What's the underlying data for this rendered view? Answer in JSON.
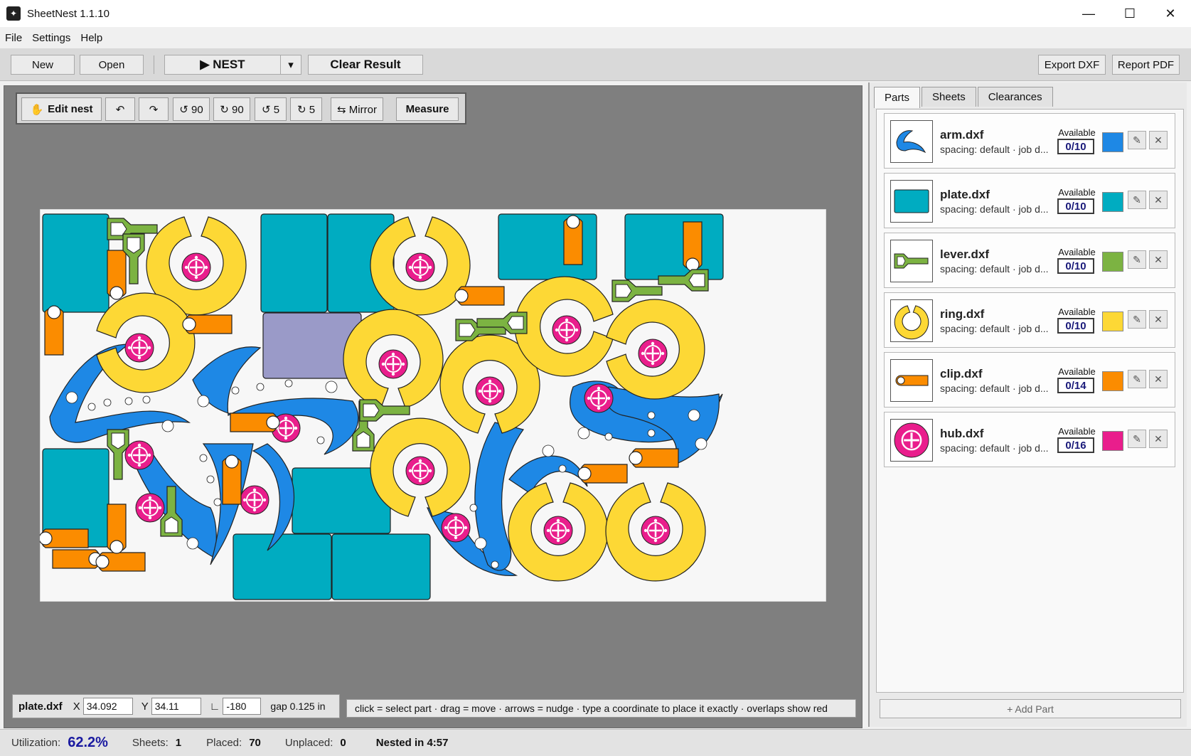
{
  "window": {
    "title": "SheetNest 1.1.10",
    "app_icon": "nest-icon"
  },
  "menu": [
    "File",
    "Settings",
    "Help"
  ],
  "toolbar": {
    "new": "New",
    "open": "Open",
    "nest": "▶  NEST",
    "nest_dropdown": "▾",
    "clear": "Clear Result",
    "export_dxf": "Export DXF",
    "report_pdf": "Report PDF"
  },
  "edit_toolbar": {
    "edit_nest": "Edit nest",
    "undo": "↶",
    "redo": "↷",
    "rot_ccw_90": "↺ 90",
    "rot_cw_90": "↻ 90",
    "rot_ccw_5": "↺ 5",
    "rot_cw_5": "↻ 5",
    "mirror": "⇆ Mirror",
    "measure": "Measure"
  },
  "coord_bar": {
    "part": "plate.dxf",
    "x_label": "X",
    "x": "34.092",
    "y_label": "Y",
    "y": "34.11",
    "angle_label": "∟",
    "angle": "-180",
    "gap": "gap 0.125 in"
  },
  "hint": "click = select part  ·  drag = move  ·  arrows = nudge  ·  type a coordinate to place it exactly  ·  overlaps show red",
  "tabs": [
    "Parts",
    "Sheets",
    "Clearances"
  ],
  "parts": [
    {
      "name": "arm.dxf",
      "spacing": "spacing: default · job d...",
      "available_label": "Available",
      "available": "0/10",
      "color": "#1e88e5",
      "icon": "arm-icon"
    },
    {
      "name": "plate.dxf",
      "spacing": "spacing: default · job d...",
      "available_label": "Available",
      "available": "0/10",
      "color": "#00acc1",
      "icon": "plate-icon"
    },
    {
      "name": "lever.dxf",
      "spacing": "spacing: default · job d...",
      "available_label": "Available",
      "available": "0/10",
      "color": "#7cb342",
      "icon": "lever-icon"
    },
    {
      "name": "ring.dxf",
      "spacing": "spacing: default · job d...",
      "available_label": "Available",
      "available": "0/10",
      "color": "#fdd835",
      "icon": "ring-icon"
    },
    {
      "name": "clip.dxf",
      "spacing": "spacing: default · job d...",
      "available_label": "Available",
      "available": "0/14",
      "color": "#fb8c00",
      "icon": "clip-icon"
    },
    {
      "name": "hub.dxf",
      "spacing": "spacing: default · job d...",
      "available_label": "Available",
      "available": "0/16",
      "color": "#e91e8c",
      "icon": "hub-icon"
    }
  ],
  "add_part": "+ Add Part",
  "status": {
    "utilization_label": "Utilization:",
    "utilization": "62.2%",
    "sheets_label": "Sheets:",
    "sheets": "1",
    "placed_label": "Placed:",
    "placed": "70",
    "unplaced_label": "Unplaced:",
    "unplaced": "0",
    "nested": "Nested in 4:57"
  },
  "colors": {
    "arm": "#1e88e5",
    "plate": "#00acc1",
    "lever": "#7cb342",
    "ring": "#fdd835",
    "clip": "#fb8c00",
    "hub": "#e91e8c",
    "selected_plate": "#9a9ac8"
  }
}
